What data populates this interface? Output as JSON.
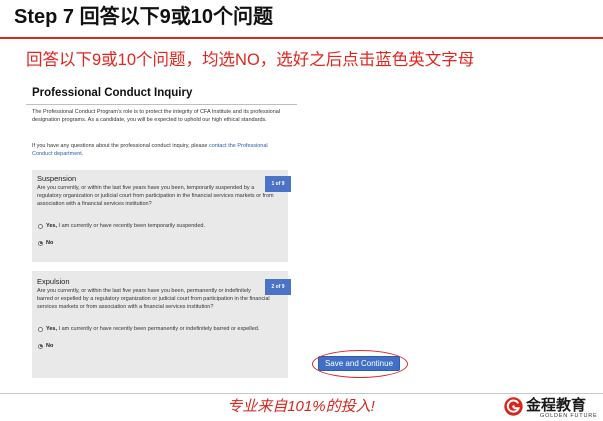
{
  "slide": {
    "title": "Step 7 回答以下9或10个问题",
    "instruction": "回答以下9或10个问题，均选NO，选好之后点击蓝色英文字母"
  },
  "colors": {
    "accent_red": "#d62a22",
    "instruction_red": "#e0261f",
    "link_blue": "#2a5db0",
    "badge_blue": "#4b74c8",
    "button_blue": "#3f70c6",
    "card_gray": "#e9e9e9"
  },
  "page": {
    "title": "Professional Conduct Inquiry",
    "intro": "The Professional Conduct Program's role is to protect the integrity of CFA Institute and its professional designation programs. As a candidate, you will be expected to uphold our high ethical standards.",
    "contact_prefix": "If you have any questions about the professional conduct inquiry, please ",
    "contact_link": "contact the Professional Conduct department",
    "contact_suffix": ".",
    "questions": [
      {
        "heading": "Suspension",
        "badge": "1 of 9",
        "text": "Are you currently, or within the last five years have you been, temporarily suspended by a regulatory organization or judicial court from participation in the financial services markets or from association with a financial services institution?",
        "options": [
          {
            "label_bold": "Yes,",
            "label_rest": " I am currently or have recently been temporarily suspended.",
            "selected": false
          },
          {
            "label_bold": "No",
            "label_rest": "",
            "selected": true
          }
        ]
      },
      {
        "heading": "Expulsion",
        "badge": "2 of 9",
        "text": "Are you currently, or within the last five years have you been, permanently or indefinitely barred or expelled by a regulatory organization or judicial court from participation in the financial services markets or from association with a financial services institution?",
        "options": [
          {
            "label_bold": "Yes,",
            "label_rest": " I am currently or have recently been permanently or indefinitely barred or expelled.",
            "selected": false
          },
          {
            "label_bold": "No",
            "label_rest": "",
            "selected": true
          }
        ]
      }
    ],
    "save_button": "Save and Continue"
  },
  "footer": {
    "slogan": "专业来自101%的投入!",
    "brand_cn": "金程教育",
    "brand_en": "GOLDEN FUTURE",
    "logo_icon": "golden-future-logo-icon"
  }
}
